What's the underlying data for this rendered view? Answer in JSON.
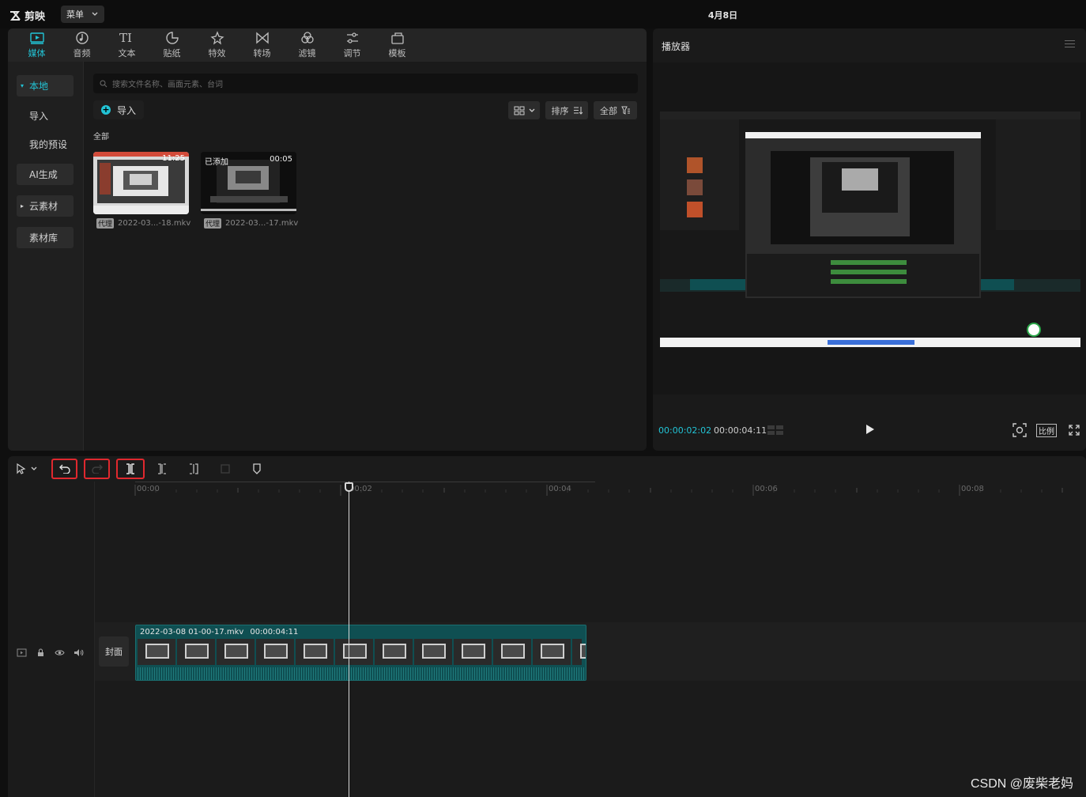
{
  "app": {
    "name": "剪映",
    "menu_label": "菜单",
    "date": "4月8日"
  },
  "media": {
    "tabs": [
      {
        "label": "媒体",
        "icon": "media-icon",
        "active": true
      },
      {
        "label": "音频",
        "icon": "audio-icon"
      },
      {
        "label": "文本",
        "icon": "text-icon"
      },
      {
        "label": "贴纸",
        "icon": "sticker-icon"
      },
      {
        "label": "特效",
        "icon": "effects-icon"
      },
      {
        "label": "转场",
        "icon": "transition-icon"
      },
      {
        "label": "滤镜",
        "icon": "filter-icon"
      },
      {
        "label": "调节",
        "icon": "adjust-icon"
      },
      {
        "label": "模板",
        "icon": "template-icon"
      }
    ],
    "sidebar": [
      {
        "label": "本地",
        "active": true
      },
      {
        "label": "导入"
      },
      {
        "label": "我的预设"
      },
      {
        "label": "AI生成"
      },
      {
        "label": "云素材"
      },
      {
        "label": "素材库"
      }
    ],
    "search_placeholder": "搜索文件名称、画面元素、台词",
    "import_label": "导入",
    "sort_label": "排序",
    "filter_label": "全部",
    "section_label": "全部",
    "items": [
      {
        "proxy_badge": "代理",
        "filename": "2022-03...-18.mkv",
        "duration": "11:25",
        "added_label": ""
      },
      {
        "proxy_badge": "代理",
        "filename": "2022-03...-17.mkv",
        "duration": "00:05",
        "added_label": "已添加"
      }
    ]
  },
  "player": {
    "title": "播放器",
    "current_time": "00:00:02:02",
    "total_time": "00:00:04:11",
    "ratio_label": "比例"
  },
  "timeline": {
    "ruler_labels": [
      "00:00",
      "00:02",
      "00:04",
      "00:06",
      "00:08"
    ],
    "clip": {
      "name": "2022-03-08 01-00-17.mkv",
      "duration": "00:00:04:11"
    },
    "cover_label": "封面"
  },
  "watermark": "CSDN @废柴老妈",
  "colors": {
    "accent": "#22c4d6",
    "highlight": "#e0282e",
    "clip": "#0f4f52"
  }
}
